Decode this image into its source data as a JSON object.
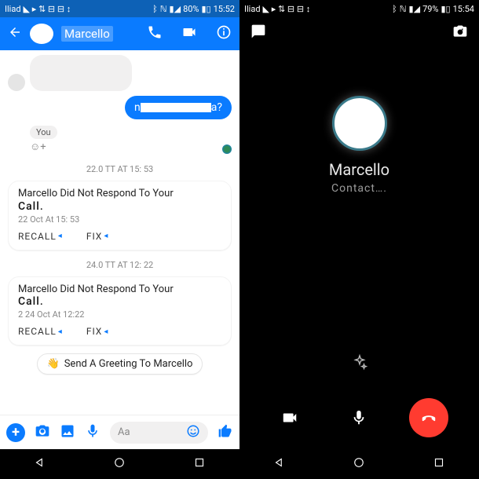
{
  "left": {
    "status": {
      "carrier": "Iliad",
      "battery": "80%",
      "time": "15:52"
    },
    "header": {
      "name": "Marcello"
    },
    "chat": {
      "blue_prefix": "n",
      "blue_suffix": "a?",
      "you_label": "You",
      "emoji_add": "☺+",
      "ts1": "22.0 TT AT 15: 53",
      "call1": {
        "line": "Marcello Did Not Respond To Your",
        "word": "Call.",
        "sub": "22 Oct At 15: 53",
        "recall": "RECALL",
        "fix": "FIX"
      },
      "ts2": "24.0 TT AT 12: 22",
      "call2": {
        "line": "Marcello Did Not Respond To Your",
        "word": "Call.",
        "sub": "2 24 Oct At 12:22",
        "recall": "RECALL",
        "fix": "FIX"
      },
      "greeting": "Send A Greeting To Marcello"
    },
    "composer": {
      "placeholder": "Aa"
    }
  },
  "right": {
    "status": {
      "carrier": "Iliad",
      "battery": "79%",
      "time": "15:54"
    },
    "call": {
      "name": "Marcello",
      "status": "Contact…."
    }
  }
}
